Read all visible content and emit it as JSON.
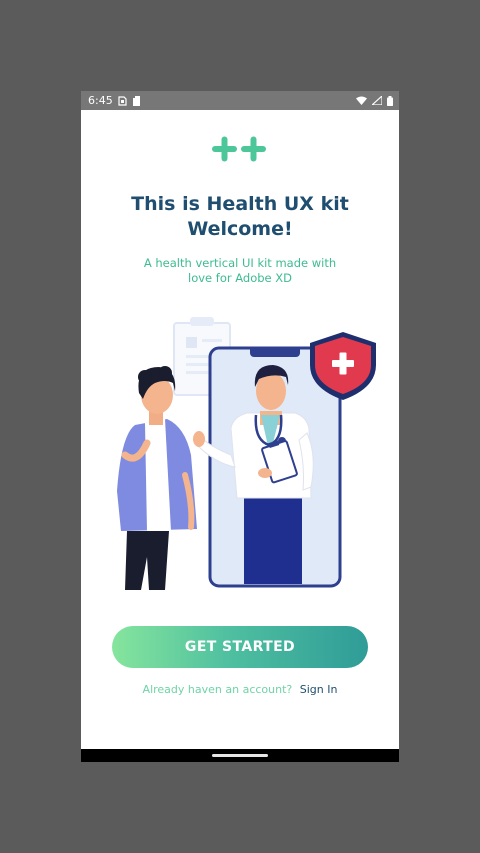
{
  "status_bar": {
    "time": "6:45",
    "icons_left": [
      "sim-card-icon",
      "sd-card-icon"
    ],
    "icons_right": [
      "wifi-icon",
      "cell-signal-icon",
      "battery-icon"
    ]
  },
  "logo": {
    "icon": "double-plus-logo-icon",
    "color": "#4cc79a"
  },
  "welcome": {
    "title_line1": "This is Health UX kit",
    "title_line2": "Welcome!",
    "subtitle_line1": "A health vertical UI kit made with",
    "subtitle_line2": "love for Adobe XD"
  },
  "illustration": {
    "icon": "doctor-patient-phone-illustration"
  },
  "actions": {
    "get_started_label": "GET STARTED",
    "signin_prompt": "Already haven an account?",
    "signin_label": "Sign In"
  },
  "colors": {
    "title": "#1f4e70",
    "accent": "#3dbb93",
    "button_gradient_start": "#86e59d",
    "button_gradient_end": "#2f9c97"
  }
}
